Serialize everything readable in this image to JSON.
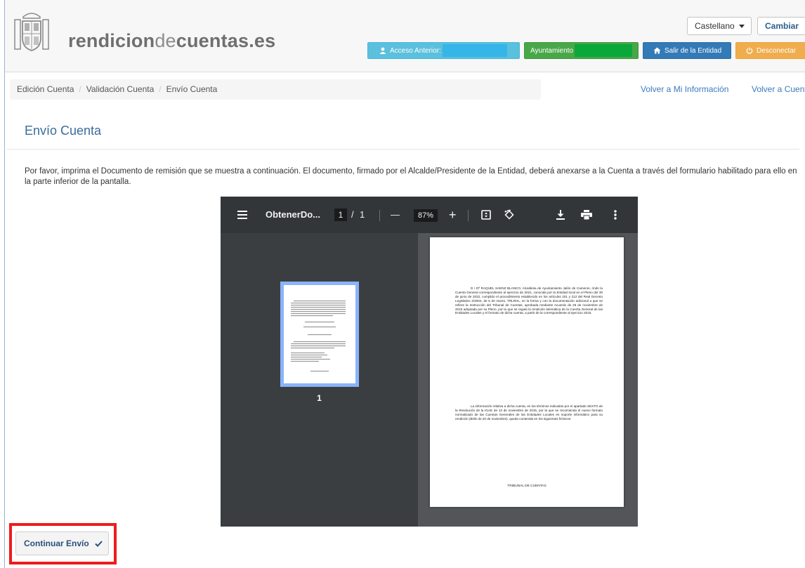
{
  "header": {
    "site_name_bold_1": "rendicion",
    "site_name_light": "de",
    "site_name_bold_2": "cuentas.es",
    "language": "Castellano",
    "change_label": "Cambiar",
    "acceso_label": "Acceso Anterior:",
    "ayuntamiento_label": "Ayuntamiento",
    "salir_label": "Salir de la Entidad",
    "desconectar_label": "Desconectar"
  },
  "breadcrumb": {
    "items": [
      "Edición Cuenta",
      "Validación Cuenta",
      "Envío Cuenta"
    ],
    "separator": "/"
  },
  "top_links": {
    "volver_info": "Volver a Mi Información",
    "volver_cuentas": "Volver a Cuentas"
  },
  "page": {
    "title": "Envío Cuenta",
    "intro": "Por favor, imprima el Documento de remisión que se muestra a continuación. El documento, firmado por el Alcalde/Presidente de la Entidad, deberá anexarse a la Cuenta a través del formulario habilitado para ello en la parte inferior de la pantalla."
  },
  "pdf_viewer": {
    "file_name": "ObtenerDo...",
    "current_page": "1",
    "page_separator": "/",
    "total_pages": "1",
    "zoom": "87%",
    "minus": "—",
    "plus": "+",
    "thumbnail_label": "1",
    "doc_paragraph_1": "D / Dª RAQUEL SAENZ BLANCO, Alcaldesa de Ayuntamiento Jalón de Cameros, rindo la Cuenta General correspondiente al ejercicio de 2021, conocida por la Entidad local en el Pleno del 30 de junio de 2022, cumplido el procedimiento establecido en los artículos 201 y 212 del Real Decreto Legislativo 2/2004, de 5 de marzo, TRLRHL, en la forma y con la documentación adicional a que se refiere la Instrucción del Tribunal de Cuentas, aprobada mediante Acuerdo de 26 de noviembre de 2015 adoptada por su Pleno, por la que se regula la rendición telemática de la Cuenta General de las Entidades Locales y el formato de dicha cuenta, a partir de la correspondiente al ejercicio 2015.",
    "doc_paragraph_2": "La información relativa a dicha cuenta, en los términos indicados por el apartado SEXTO de la Resolución de la IGAE de 13 de noviembre de 2015, por la que se recomienda el nuevo formato normalizado de las Cuentas Generales de las Entidades Locales en soporte informático para su rendición (BOE de 20 de noviembre), queda contenida en los siguientes ficheros:",
    "doc_footer": "TRIBUNAL DE CUENTAS"
  },
  "actions": {
    "continue_label": "Continuar Envío"
  },
  "colors": {
    "acceso": "#5bc0de",
    "ayuntamiento": "#48a848",
    "salir": "#337ab7",
    "desconectar": "#f0ad4e",
    "highlight": "#ee1c1c",
    "title": "#3a6d99"
  },
  "icons": {
    "acceso": "user-icon",
    "salir": "home-icon",
    "desconectar": "power-icon",
    "menu": "menu-icon",
    "fit": "fit-page-icon",
    "rotate": "rotate-icon",
    "download": "download-icon",
    "print": "print-icon",
    "more": "more-vert-icon",
    "continue": "check-icon"
  }
}
